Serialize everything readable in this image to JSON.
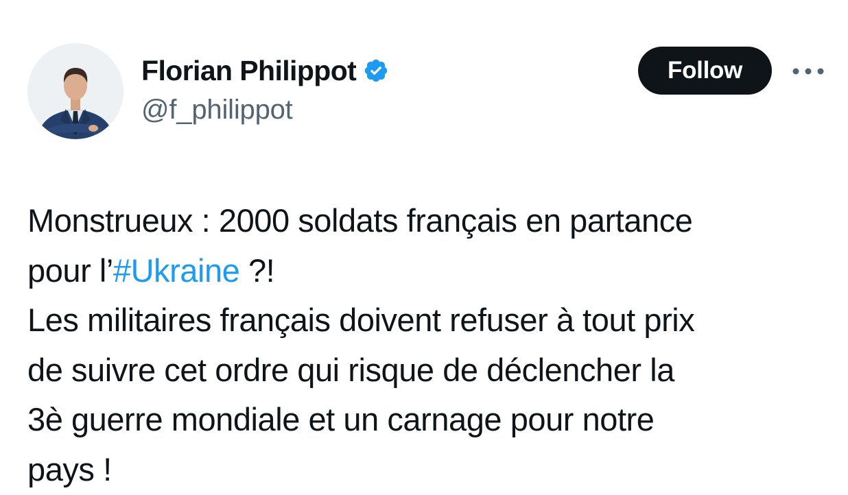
{
  "author": {
    "display_name": "Florian Philippot",
    "handle": "@f_philippot",
    "verified": true,
    "verified_icon": "verified-badge-icon",
    "verified_color": "#1d9bf0",
    "avatar_icon": "profile-photo"
  },
  "actions": {
    "follow_label": "Follow",
    "more_icon": "more-options-icon"
  },
  "tweet": {
    "lines": [
      {
        "before": "Monstrueux : 2000 soldats français en partance",
        "hashtag": "",
        "after": ""
      },
      {
        "before": "pour l’",
        "hashtag": "#Ukraine",
        "after": " ?!"
      },
      {
        "before": "Les militaires français doivent refuser à tout prix",
        "hashtag": "",
        "after": ""
      },
      {
        "before": "de suivre cet ordre qui risque de déclencher la",
        "hashtag": "",
        "after": ""
      },
      {
        "before": "3è guerre mondiale et un carnage pour notre",
        "hashtag": "",
        "after": ""
      },
      {
        "before": "pays !",
        "hashtag": "",
        "after": ""
      }
    ]
  },
  "colors": {
    "text": "#0f1419",
    "secondary_text": "#536471",
    "link": "#1d9bf0",
    "follow_button_bg": "#0f1419"
  }
}
